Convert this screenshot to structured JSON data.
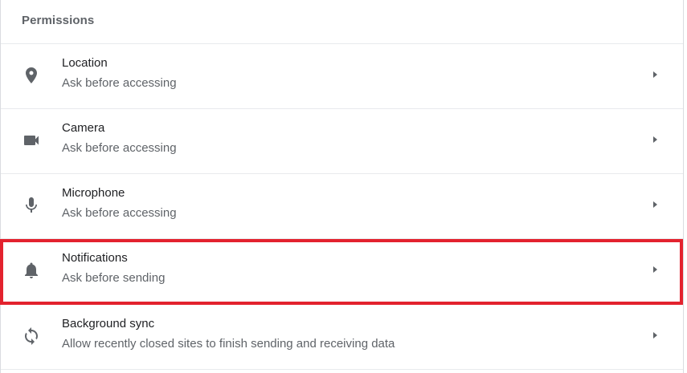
{
  "section": {
    "title": "Permissions"
  },
  "rows": [
    {
      "title": "Location",
      "subtitle": "Ask before accessing",
      "icon": "location-pin-icon"
    },
    {
      "title": "Camera",
      "subtitle": "Ask before accessing",
      "icon": "camera-icon"
    },
    {
      "title": "Microphone",
      "subtitle": "Ask before accessing",
      "icon": "microphone-icon"
    },
    {
      "title": "Notifications",
      "subtitle": "Ask before sending",
      "icon": "bell-icon"
    },
    {
      "title": "Background sync",
      "subtitle": "Allow recently closed sites to finish sending and receiving data",
      "icon": "sync-icon"
    }
  ],
  "highlight": {
    "color": "#e3222e",
    "target": "Notifications"
  },
  "colors": {
    "icon": "#5f6368",
    "title": "#202124",
    "subtitle": "#5f6368",
    "divider": "#e8eaed"
  }
}
